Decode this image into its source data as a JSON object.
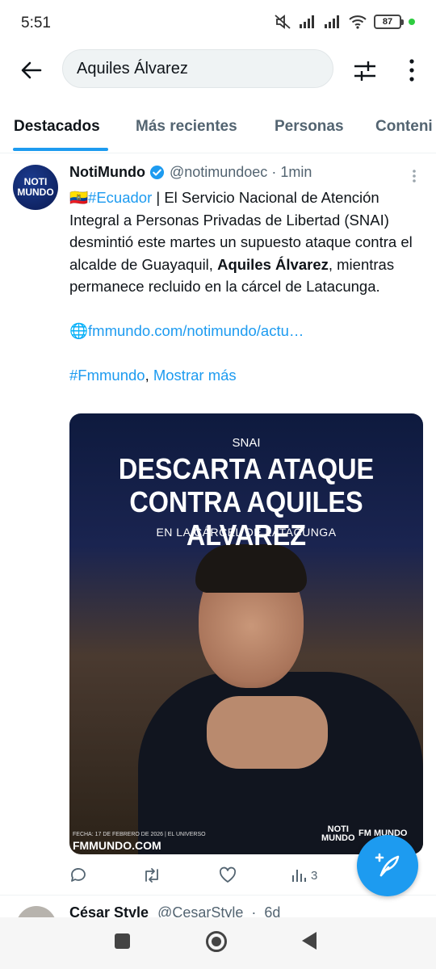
{
  "status_bar": {
    "time": "5:51",
    "battery": "87"
  },
  "search": {
    "query": "Aquiles Álvarez"
  },
  "tabs": [
    {
      "label": "Destacados",
      "active": true
    },
    {
      "label": "Más recientes",
      "active": false
    },
    {
      "label": "Personas",
      "active": false
    },
    {
      "label": "Conteni",
      "active": false
    }
  ],
  "tweet": {
    "author_name": "NotiMundo",
    "handle": "@notimundoec",
    "separator": "·",
    "time": "1min",
    "avatar_text_top": "NOTI",
    "avatar_text_bottom": "MUNDO",
    "flag": "🇪🇨",
    "hashtag_country": "#Ecuador",
    "text_part1": " | El Servicio Nacional de Atención Integral a Personas Privadas de Libertad (SNAI) desmintió este martes un supuesto ataque contra el alcalde de Guayaquil, ",
    "text_bold": "Aquiles Álvarez",
    "text_part2": ", mientras permanece recluido en la cárcel de Latacunga.",
    "link_icon": "🌐",
    "link": "fmmundo.com/notimundo/actu…",
    "hashtag_end": "#Fmmundo",
    "comma": ", ",
    "show_more": "Mostrar más",
    "media": {
      "kicker": "SNAI",
      "headline_line1": "DESCARTA ATAQUE",
      "headline_line2": "CONTRA AQUILES ALVAREZ",
      "subheadline": "EN LA CÁRCEL DE LATACUNGA",
      "date_caption": "FECHA: 17 DE FEBRERO DE 2026 | EL UNIVERSO",
      "site": "FMMUNDO.COM",
      "logo1_top": "NOTI",
      "logo1_bottom": "MUNDO",
      "logo2": "FM MUNDO"
    },
    "actions": {
      "views": "3"
    }
  },
  "next_tweet": {
    "author_name": "César Style",
    "handle": "@CesarStyle",
    "separator": "·",
    "time": "6d"
  },
  "colors": {
    "accent": "#1d9bf0",
    "text": "#0f1419",
    "muted": "#536471"
  }
}
